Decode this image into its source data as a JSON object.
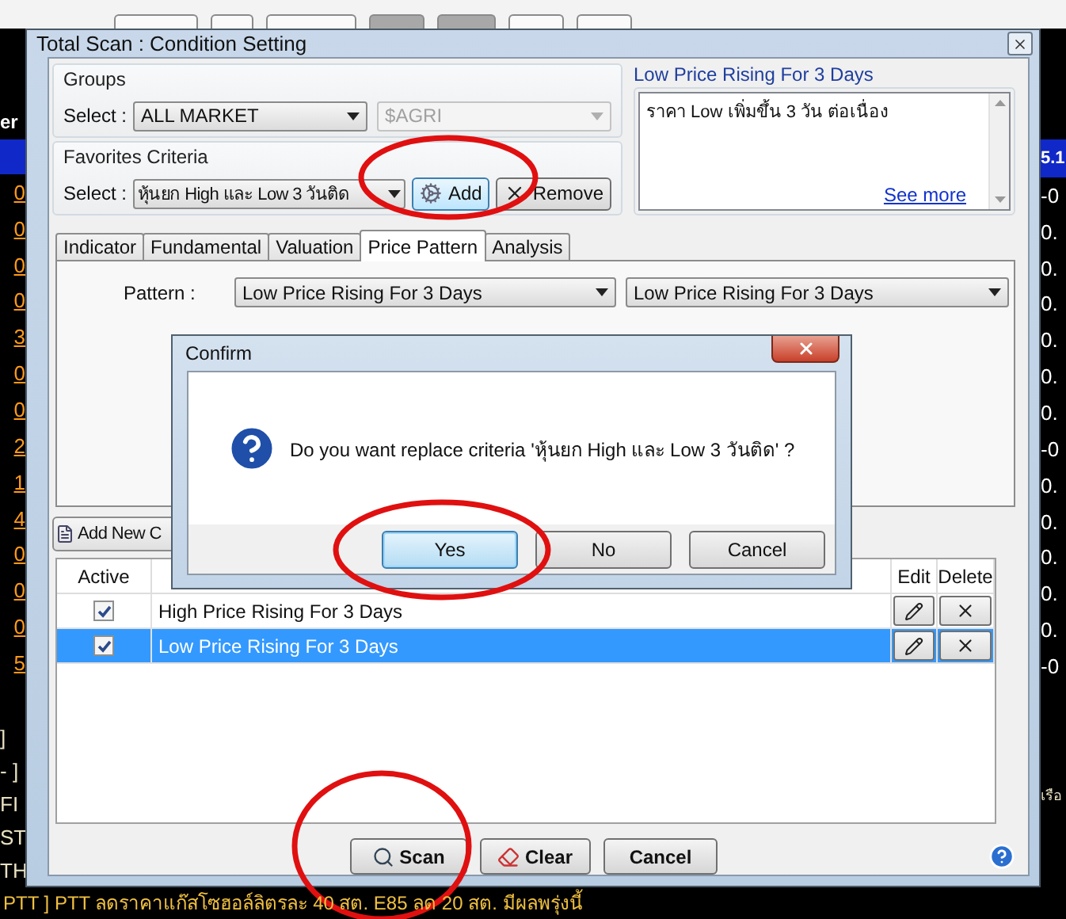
{
  "background_app": {
    "left_edge": {
      "header": "er",
      "prices": [
        "0",
        "0",
        "0",
        "0",
        "3",
        "0",
        "0",
        "2",
        "1",
        "4",
        "0",
        "0",
        "0",
        "5"
      ],
      "news_tags": [
        "]",
        "- ]",
        "FI",
        "ST",
        "TH"
      ]
    },
    "right_edge": {
      "header": "5.1",
      "changes": [
        "-0",
        "0.",
        "0.",
        "0.",
        "0.",
        "0.",
        "0.",
        "-0",
        "0.",
        "0.",
        "0.",
        "0.",
        "0.",
        "-0"
      ],
      "news_tail": "เรือ"
    },
    "news_ticker": "PTT ] PTT ลดราคาแก๊สโซฮอล์ลิตรละ 40 สต. E85 ลด 20 สต. มีผลพรุ่งนี้"
  },
  "dialog": {
    "title": "Total Scan : Condition Setting",
    "groups": {
      "label": "Groups",
      "select_label": "Select :",
      "group": "ALL MARKET",
      "subgroup": {
        "value": "$AGRI",
        "disabled": true
      }
    },
    "favorites": {
      "label": "Favorites Criteria",
      "select_label": "Select :",
      "value": "หุ้นยก High และ Low 3 วันติด",
      "add_button": "Add",
      "remove_button": "Remove"
    },
    "description": {
      "title": "Low Price Rising For 3 Days",
      "text": "ราคา Low เพิ่มขึ้น 3 วัน ต่อเนื่อง",
      "link": "See more"
    },
    "tabs": [
      {
        "label": "Indicator",
        "selected": false
      },
      {
        "label": "Fundamental",
        "selected": false
      },
      {
        "label": "Valuation",
        "selected": false
      },
      {
        "label": "Price Pattern",
        "selected": true
      },
      {
        "label": "Analysis",
        "selected": false
      }
    ],
    "pattern": {
      "label": "Pattern :",
      "values": [
        "Low Price Rising For 3 Days",
        "Low Price Rising For 3 Days"
      ]
    },
    "add_new_button": "Add New C",
    "criteria_table": {
      "columns": [
        "Active",
        "Edit",
        "Delete"
      ],
      "rows": [
        {
          "name": "High Price Rising For 3 Days",
          "checked": true,
          "selected": false
        },
        {
          "name": "Low Price Rising For 3 Days",
          "checked": true,
          "selected": true
        }
      ]
    },
    "buttons": [
      {
        "label": "Scan",
        "kind": "scan"
      },
      {
        "label": "Clear",
        "kind": "clear"
      },
      {
        "label": "Cancel",
        "kind": "cancel"
      }
    ]
  },
  "confirm": {
    "title": "Confirm",
    "message": "Do you want replace criteria 'หุ้นยก High และ Low 3 วันติด' ?",
    "buttons": [
      {
        "label": "Yes",
        "default": true
      },
      {
        "label": "No",
        "default": false
      },
      {
        "label": "Cancel",
        "default": false
      }
    ]
  }
}
